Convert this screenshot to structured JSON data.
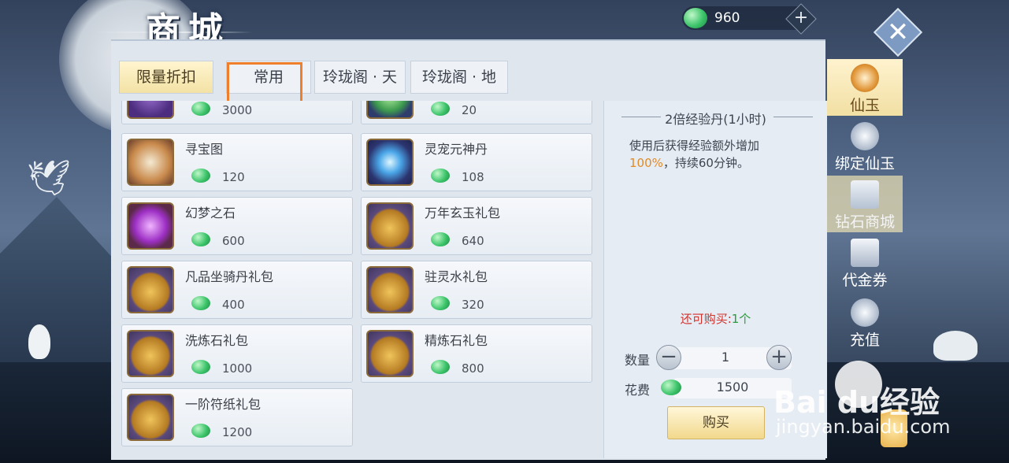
{
  "header": {
    "title": "商城",
    "currency_value": "960",
    "add_label": "+",
    "close_label": "✕"
  },
  "tabs": [
    {
      "label": "限量折扣",
      "active": true
    },
    {
      "label": "常用",
      "active": false
    },
    {
      "label": "玲珑阁 · 天",
      "active": false
    },
    {
      "label": "玲珑阁 · 地",
      "active": false
    }
  ],
  "items": [
    {
      "name": "",
      "price": "3000",
      "icon": "purple-item-icon"
    },
    {
      "name": "",
      "price": "20",
      "icon": "green-item-icon"
    },
    {
      "name": "寻宝图",
      "price": "120",
      "icon": "treasure-map-icon"
    },
    {
      "name": "灵宠元神丹",
      "price": "108",
      "icon": "spirit-drop-icon"
    },
    {
      "name": "幻梦之石",
      "price": "600",
      "icon": "purple-crystal-icon"
    },
    {
      "name": "万年玄玉礼包",
      "price": "640",
      "icon": "treasure-chest-icon"
    },
    {
      "name": "凡品坐骑丹礼包",
      "price": "400",
      "icon": "treasure-chest-icon"
    },
    {
      "name": "驻灵水礼包",
      "price": "320",
      "icon": "treasure-chest-icon"
    },
    {
      "name": "洗炼石礼包",
      "price": "1000",
      "icon": "treasure-chest-icon"
    },
    {
      "name": "精炼石礼包",
      "price": "800",
      "icon": "treasure-chest-icon"
    },
    {
      "name": "一阶符纸礼包",
      "price": "1200",
      "icon": "treasure-chest-icon"
    }
  ],
  "detail": {
    "title": "2倍经验丹(1小时)",
    "desc_before": "使用后获得经验额外增加",
    "desc_pct": "100%",
    "desc_after": "，持续60分钟。",
    "remain_label": "还可购买:",
    "remain_count": "1个",
    "qty_label": "数量",
    "qty_minus": "−",
    "qty_value": "1",
    "qty_plus": "+",
    "cost_label": "花费",
    "cost_value": "1500",
    "buy_label": "购买"
  },
  "sidebar": [
    {
      "label": "仙玉",
      "state": "active"
    },
    {
      "label": "绑定仙玉",
      "state": "normal"
    },
    {
      "label": "钻石商城",
      "state": "dim"
    },
    {
      "label": "代金券",
      "state": "normal"
    },
    {
      "label": "充值",
      "state": "normal"
    }
  ],
  "watermark": {
    "brand": "Bai  du经验",
    "url": "jingyan.baidu.com"
  },
  "colors": {
    "highlight": "#f07f2b",
    "price_pct": "#e08a2a",
    "remain": "#d4302a",
    "remain_count": "#2b9a3b"
  }
}
